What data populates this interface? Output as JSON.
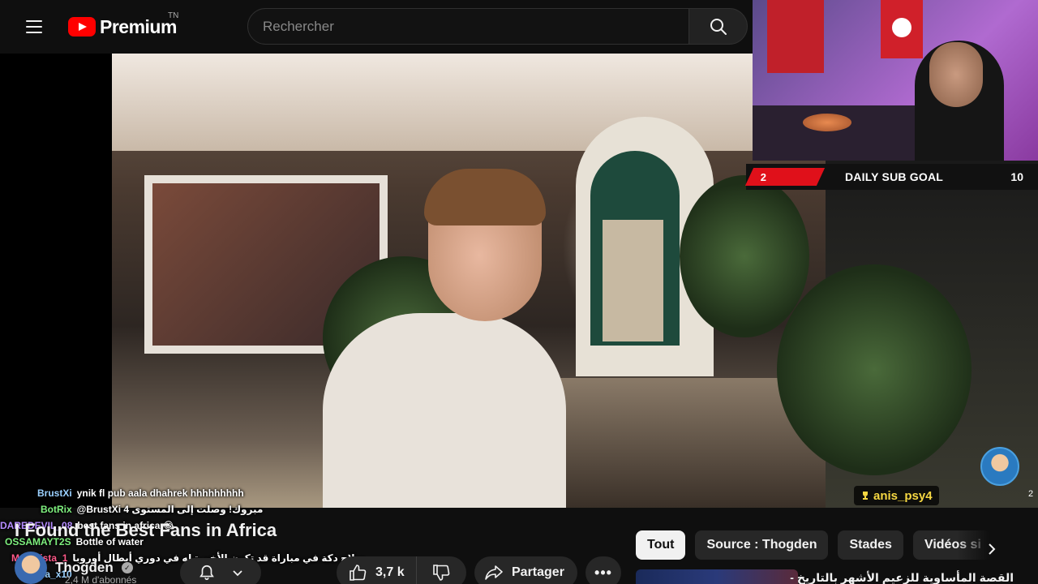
{
  "header": {
    "logo_text": "Premium",
    "country_code": "TN",
    "search_placeholder": "Rechercher"
  },
  "stream_overlay": {
    "sub_goal_current": "2",
    "sub_goal_label": "DAILY SUB GOAL",
    "sub_goal_target": "10",
    "highlighted_user": "anis_psy4",
    "viewer_side_count": "2"
  },
  "chat": [
    {
      "user": "BrustXi",
      "color": "#9ad0ff",
      "message": "ynik fl pub aala dhahrek hhhhhhhhh"
    },
    {
      "user": "BotRix",
      "color": "#7ef07e",
      "message": "@BrustXi مبروك! وصلت إلى المستوى 4"
    },
    {
      "user": "DAREDEVIL_08",
      "color": "#b58cff",
      "message": "best fans in africa 😂"
    },
    {
      "user": "OSSAMAYT2S",
      "color": "#7ef07e",
      "message": "Bottle of water"
    },
    {
      "user": "Maradista_1",
      "color": "#ff5a8a",
      "message": "صلاح دكة في مباراة قد تكون الأخيرة له في دوري أبطال أوروبا"
    },
    {
      "user": "dybala_x10",
      "color": "#9ad0ff",
      "message": ""
    }
  ],
  "video": {
    "title": "I Found the Best Fans in Africa",
    "channel_name": "Thogden",
    "subscribers": "2,4 M d'abonnés",
    "likes": "3,7 k",
    "share_label": "Partager",
    "more_label": "•••"
  },
  "chips": [
    {
      "label": "Tout",
      "active": true
    },
    {
      "label": "Source : Thogden",
      "active": false
    },
    {
      "label": "Stades",
      "active": false
    },
    {
      "label": "Vidéos si",
      "active": false
    }
  ],
  "recommendation": {
    "title": "القصة المأساوية للزعيم الأشهر بالتاريخ -"
  }
}
